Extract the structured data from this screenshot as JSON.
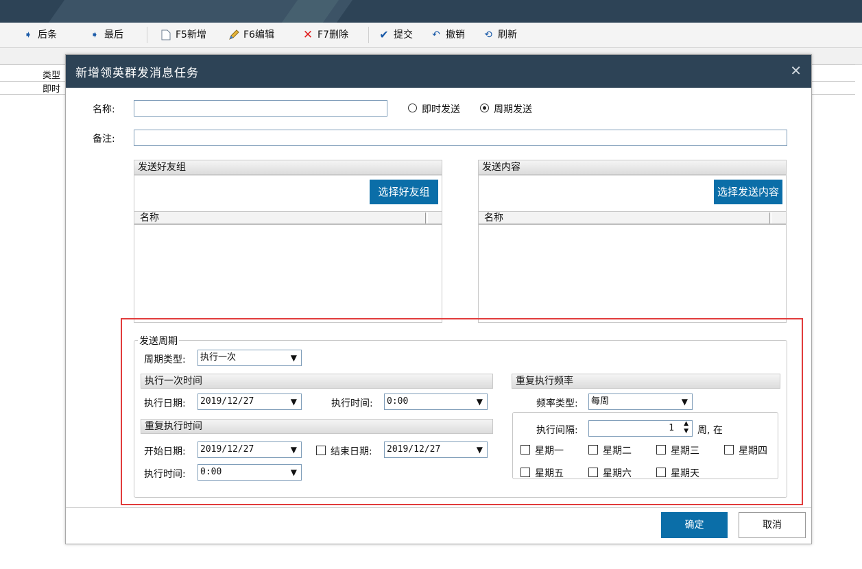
{
  "toolbar": {
    "next": "后条",
    "last": "最后",
    "add": "F5新增",
    "edit": "F6编辑",
    "delete": "F7删除",
    "submit": "提交",
    "undo": "撤销",
    "refresh": "刷新"
  },
  "background_grid": {
    "header": "类型",
    "row1": "即时"
  },
  "dialog": {
    "title": "新增领英群发消息任务",
    "close": "✕",
    "name_label": "名称:",
    "name_value": "",
    "radio_instant": "即时发送",
    "radio_periodic": "周期发送",
    "remark_label": "备注:",
    "remark_value": "",
    "friend_group": {
      "title": "发送好友组",
      "button": "选择好友组",
      "column": "名称"
    },
    "content": {
      "title": "发送内容",
      "button": "选择发送内容",
      "column": "名称"
    },
    "cycle": {
      "legend": "发送周期",
      "type_label": "周期类型:",
      "type_value": "执行一次",
      "once_title": "执行一次时间",
      "exec_date_label": "执行日期:",
      "exec_date_value": "2019/12/27",
      "exec_time_label": "执行时间:",
      "exec_time_value": "0:00",
      "repeat_title": "重复执行时间",
      "start_date_label": "开始日期:",
      "start_date_value": "2019/12/27",
      "end_date_label": "结束日期:",
      "end_date_value": "2019/12/27",
      "repeat_time_label": "执行时间:",
      "repeat_time_value": "0:00",
      "freq_title": "重复执行频率",
      "freq_type_label": "频率类型:",
      "freq_type_value": "每周",
      "interval_label": "执行间隔:",
      "interval_value": "1",
      "interval_unit": "周, 在",
      "weekdays": [
        "星期一",
        "星期二",
        "星期三",
        "星期四",
        "星期五",
        "星期六",
        "星期天"
      ]
    },
    "ok": "确定",
    "cancel": "取消"
  },
  "colors": {
    "title_bar": "#2d4356",
    "accent": "#0b6ea8",
    "highlight_box": "#e13b3b"
  }
}
